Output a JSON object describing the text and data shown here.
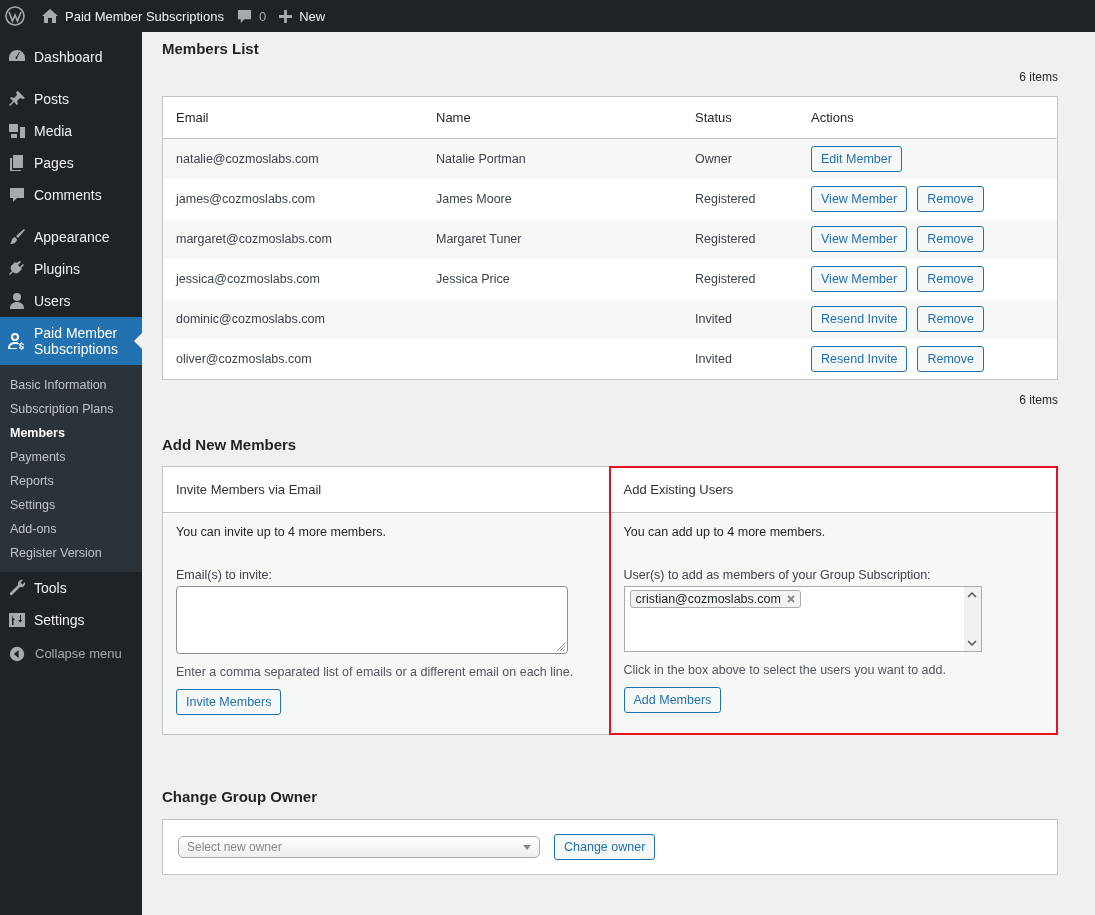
{
  "admin_bar": {
    "site": "Paid Member Subscriptions",
    "comments": "0",
    "new": "New"
  },
  "sidebar": {
    "items": [
      {
        "kind": "item",
        "label": "Dashboard",
        "selected": false
      },
      {
        "kind": "separator"
      },
      {
        "kind": "item",
        "label": "Posts",
        "selected": false
      },
      {
        "kind": "item",
        "label": "Media",
        "selected": false
      },
      {
        "kind": "item",
        "label": "Pages",
        "selected": false
      },
      {
        "kind": "item",
        "label": "Comments",
        "selected": false
      },
      {
        "kind": "separator"
      },
      {
        "kind": "item",
        "label": "Appearance",
        "selected": false
      },
      {
        "kind": "item",
        "label": "Plugins",
        "selected": false
      },
      {
        "kind": "item",
        "label": "Users",
        "selected": false
      },
      {
        "kind": "item",
        "label": "Paid Member Subscriptions",
        "selected": true,
        "children": [
          {
            "label": "Basic Information",
            "selected": false
          },
          {
            "label": "Subscription Plans",
            "selected": false
          },
          {
            "label": "Members",
            "selected": true
          },
          {
            "label": "Payments",
            "selected": false
          },
          {
            "label": "Reports",
            "selected": false
          },
          {
            "label": "Settings",
            "selected": false
          },
          {
            "label": "Add-ons",
            "selected": false
          },
          {
            "label": "Register Version",
            "selected": false
          }
        ]
      },
      {
        "kind": "item",
        "label": "Tools",
        "selected": false
      },
      {
        "kind": "item",
        "label": "Settings",
        "selected": false
      }
    ],
    "collapse": "Collapse menu"
  },
  "members_list": {
    "title": "Members List",
    "count_top": "6 items",
    "count_bottom": "6 items",
    "columns": [
      "Email",
      "Name",
      "Status",
      "Actions"
    ],
    "rows": [
      {
        "email": "natalie@cozmoslabs.com",
        "name": "Natalie Portman",
        "status": "Owner",
        "actions": [
          "Edit Member"
        ]
      },
      {
        "email": "james@cozmoslabs.com",
        "name": "James Moore",
        "status": "Registered",
        "actions": [
          "View Member",
          "Remove"
        ]
      },
      {
        "email": "margaret@cozmoslabs.com",
        "name": "Margaret Tuner",
        "status": "Registered",
        "actions": [
          "View Member",
          "Remove"
        ]
      },
      {
        "email": "jessica@cozmoslabs.com",
        "name": "Jessica Price",
        "status": "Registered",
        "actions": [
          "View Member",
          "Remove"
        ]
      },
      {
        "email": "dominic@cozmoslabs.com",
        "name": "",
        "status": "Invited",
        "actions": [
          "Resend Invite",
          "Remove"
        ]
      },
      {
        "email": "oliver@cozmoslabs.com",
        "name": "",
        "status": "Invited",
        "actions": [
          "Resend Invite",
          "Remove"
        ]
      }
    ]
  },
  "add_new_members": {
    "title": "Add New Members",
    "panels": [
      {
        "kind": "textarea",
        "title": "Invite Members via Email",
        "highlighted": false,
        "note": "You can invite up to 4 more members.",
        "field_label": "Email(s) to invite:",
        "help": "Enter a comma separated list of emails or a different email on each line.",
        "button": "Invite Members"
      },
      {
        "kind": "tags",
        "title": "Add Existing Users",
        "highlighted": true,
        "note": "You can add up to 4 more members.",
        "field_label": "User(s) to add as members of your Group Subscription:",
        "tags": [
          "cristian@cozmoslabs.com"
        ],
        "help": "Click in the box above to select the users you want to add.",
        "button": "Add Members"
      }
    ]
  },
  "change_owner": {
    "title": "Change Group Owner",
    "select_placeholder": "Select new owner",
    "button": "Change owner"
  }
}
